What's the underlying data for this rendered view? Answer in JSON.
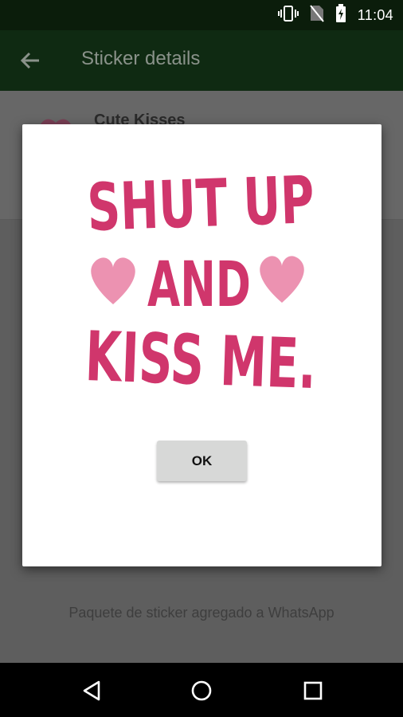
{
  "status_bar": {
    "time": "11:04",
    "icons": [
      "vibrate-icon",
      "no-sim-icon",
      "battery-charging-icon"
    ]
  },
  "toolbar": {
    "title": "Sticker details",
    "back_icon": "arrow-back-icon"
  },
  "pack": {
    "name": "Cute Kisses",
    "added_message": "Paquete de sticker agregado a WhatsApp"
  },
  "dialog": {
    "sticker_text_lines": [
      "SHUT UP",
      "AND",
      "KISS ME."
    ],
    "sticker_color": "#d0366c",
    "heart_color": "#e86d96",
    "ok_label": "OK"
  },
  "nav_bar": {
    "icons": [
      "back-triangle-icon",
      "home-circle-icon",
      "recents-square-icon"
    ]
  },
  "colors": {
    "toolbar": "#0f2a12",
    "status_bar": "#0b1d0b",
    "scrim": "#5e5e5e"
  }
}
